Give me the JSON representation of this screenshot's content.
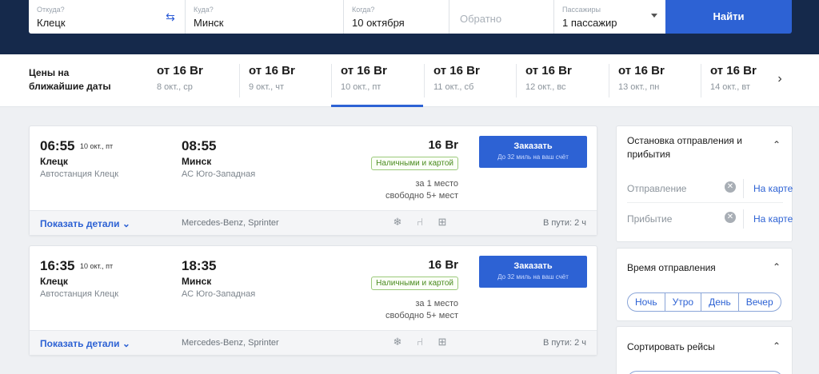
{
  "search": {
    "from": {
      "label": "Откуда?",
      "value": "Клецк"
    },
    "to": {
      "label": "Куда?",
      "value": "Минск"
    },
    "when": {
      "label": "Когда?",
      "value": "10 октября"
    },
    "back": {
      "placeholder": "Обратно"
    },
    "passengers": {
      "label": "Пассажиры",
      "value": "1 пассажир"
    },
    "find_label": "Найти"
  },
  "dates": {
    "title_line1": "Цены на",
    "title_line2": "ближайшие даты",
    "items": [
      {
        "price": "от 16 Br",
        "date": "8 окт., ср"
      },
      {
        "price": "от 16 Br",
        "date": "9 окт., чт"
      },
      {
        "price": "от 16 Br",
        "date": "10 окт., пт",
        "active": true
      },
      {
        "price": "от 16 Br",
        "date": "11 окт., сб"
      },
      {
        "price": "от 16 Br",
        "date": "12 окт., вс"
      },
      {
        "price": "от 16 Br",
        "date": "13 окт., пн"
      },
      {
        "price": "от 16 Br",
        "date": "14 окт., вт"
      }
    ]
  },
  "trips": [
    {
      "dep_time": "06:55",
      "dep_date": "10 окт., пт",
      "from": "Клецк",
      "from_station": "Автостанция Клецк",
      "arr_time": "08:55",
      "to": "Минск",
      "to_station": "АС Юго-Западная",
      "price": "16 Br",
      "payment": "Наличными и картой",
      "seats_line1": "за 1 место",
      "seats_line2": "свободно 5+ мест",
      "book_label": "Заказать",
      "book_sub": "До 32 миль на ваш счёт",
      "details_label": "Показать детали",
      "bus": "Mercedes-Benz, Sprinter",
      "duration": "В пути: 2 ч"
    },
    {
      "dep_time": "16:35",
      "dep_date": "10 окт., пт",
      "from": "Клецк",
      "from_station": "Автостанция Клецк",
      "arr_time": "18:35",
      "to": "Минск",
      "to_station": "АС Юго-Западная",
      "price": "16 Br",
      "payment": "Наличными и картой",
      "seats_line1": "за 1 место",
      "seats_line2": "свободно 5+ мест",
      "book_label": "Заказать",
      "book_sub": "До 32 миль на ваш счёт",
      "details_label": "Показать детали",
      "bus": "Mercedes-Benz, Sprinter",
      "duration": "В пути: 2 ч"
    }
  ],
  "filters": {
    "stops": {
      "title": "Остановка отправления и прибытия",
      "departure_label": "Отправление",
      "arrival_label": "Прибытие",
      "map_label": "На карте"
    },
    "time": {
      "title": "Время отправления",
      "options": [
        "Ночь",
        "Утро",
        "День",
        "Вечер"
      ]
    },
    "sort": {
      "title": "Сортировать рейсы"
    }
  },
  "icons": {
    "swap": "swap-arrows-icon",
    "amenities": [
      "snowflake-icon",
      "seat-recline-icon",
      "first-aid-icon"
    ]
  },
  "colors": {
    "accent": "#2d62d4",
    "header_bg": "#15294b",
    "badge_green": "#4a8a1f"
  }
}
